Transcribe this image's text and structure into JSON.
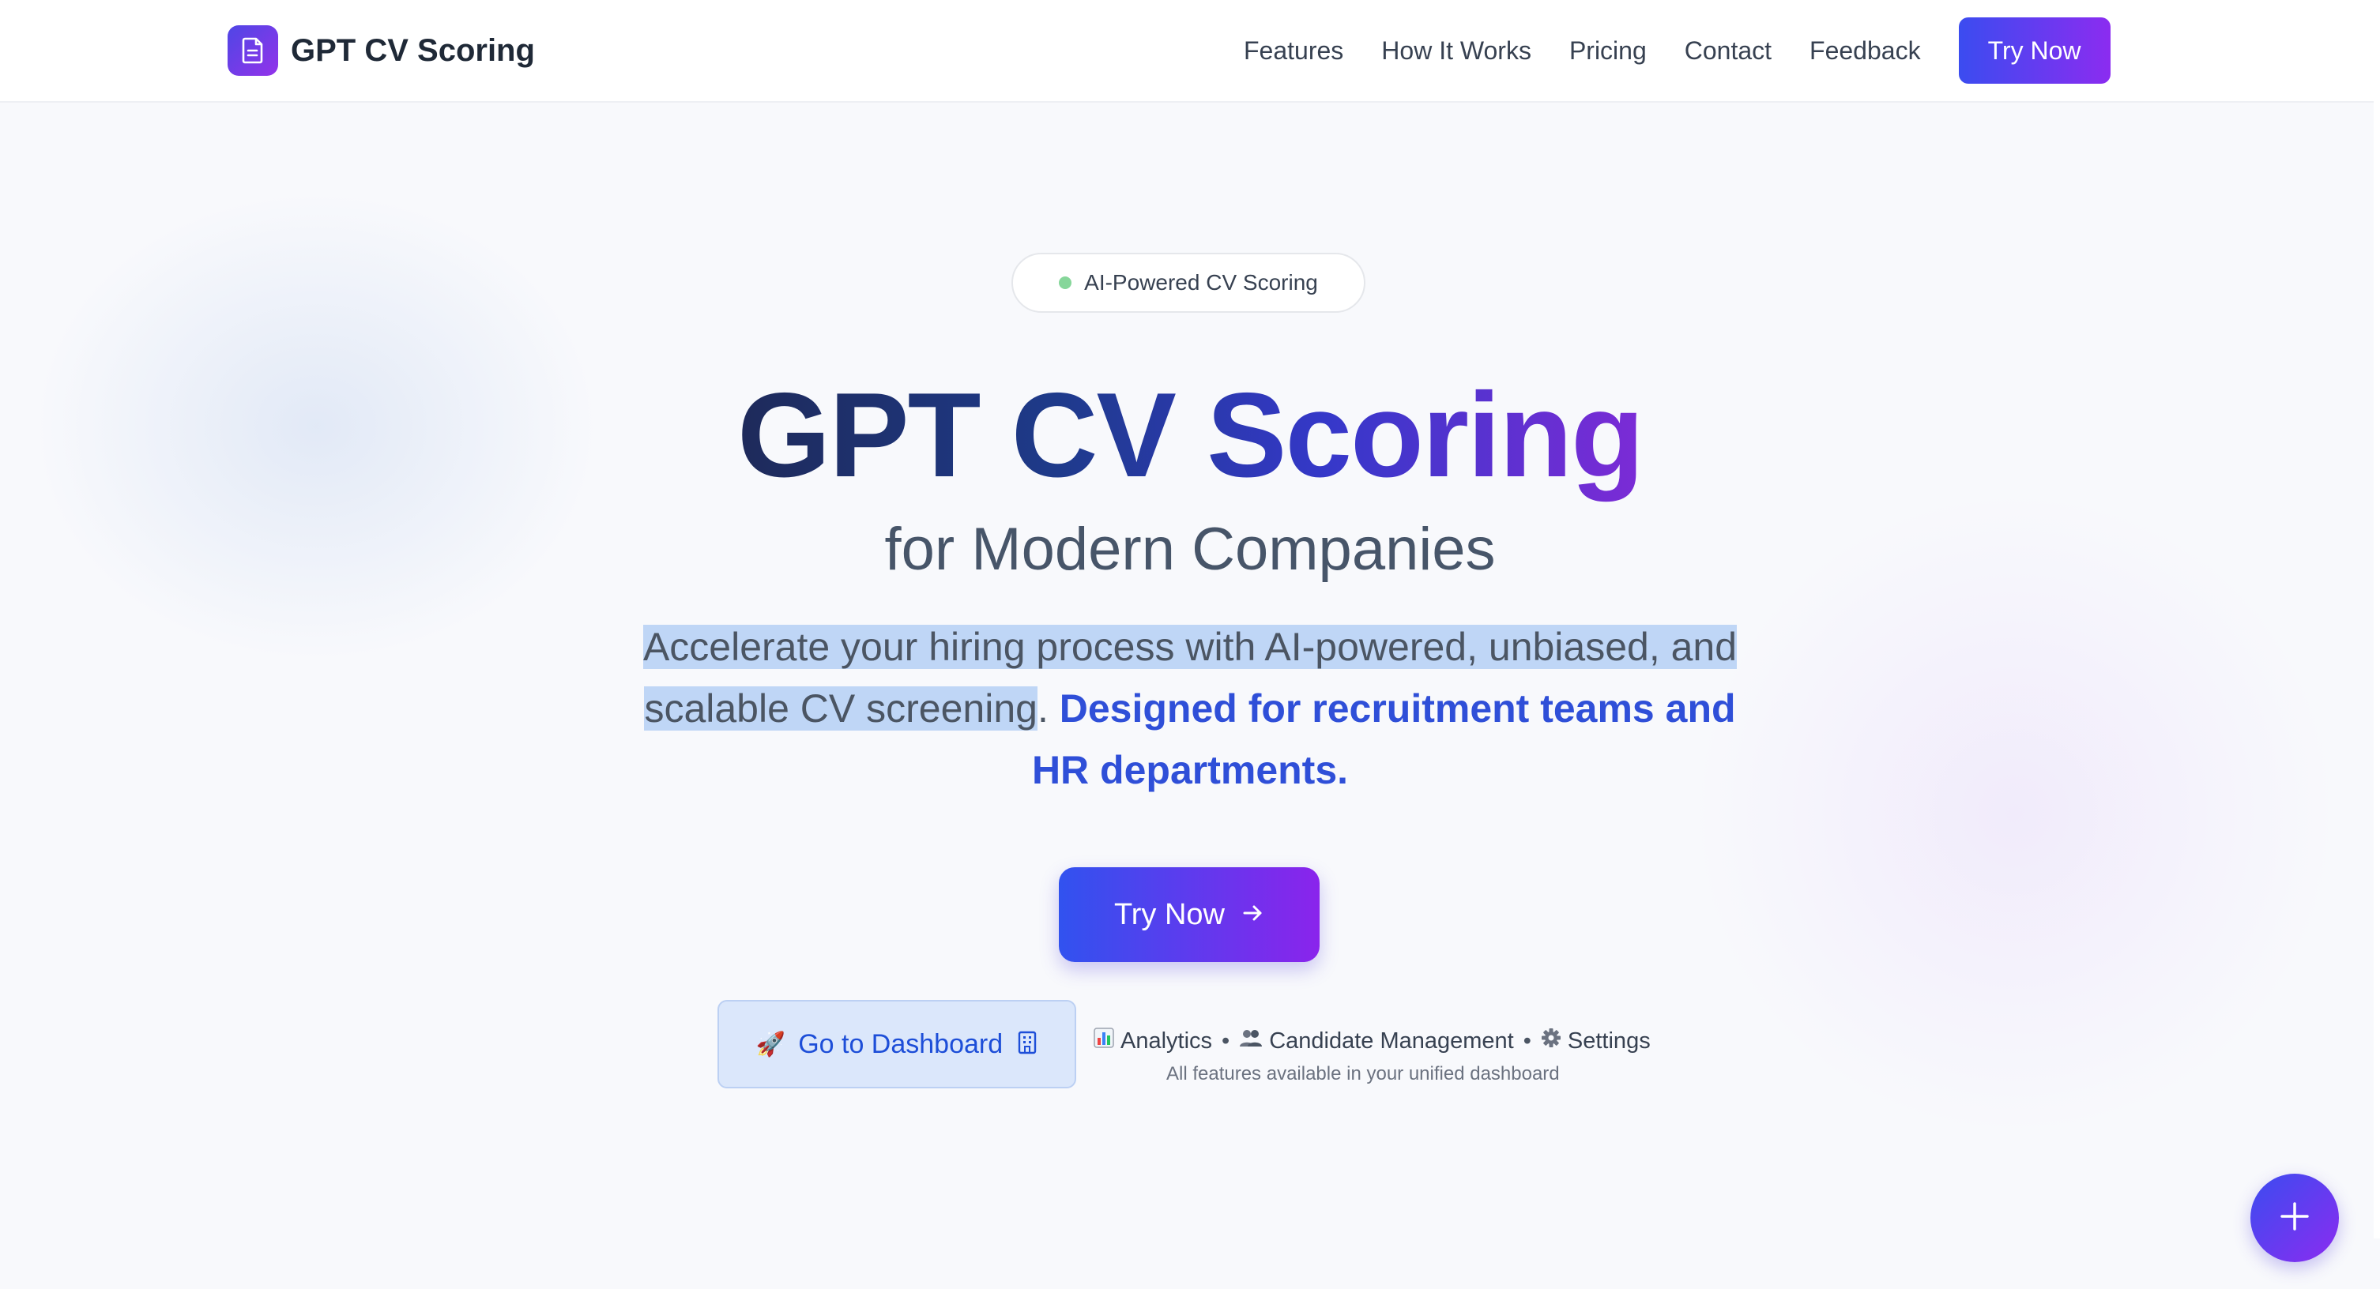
{
  "header": {
    "brand": "GPT CV Scoring",
    "brand_icon": "document-icon",
    "nav": [
      "Features",
      "How It Works",
      "Pricing",
      "Contact",
      "Feedback"
    ],
    "cta": "Try Now"
  },
  "hero": {
    "badge": "AI-Powered CV Scoring",
    "title": "GPT CV Scoring",
    "subtitle": "for Modern Companies",
    "description_highlighted": "Accelerate your hiring process with AI-powered, unbiased, and scalable CV screening",
    "description_period": ".",
    "description_accent": "Designed for recruitment teams and HR departments.",
    "cta": "Try Now",
    "cta_icon": "arrow-right-icon"
  },
  "dashboard": {
    "label": "Go to Dashboard",
    "emoji": "🚀",
    "icon": "building-icon"
  },
  "features": {
    "items": [
      {
        "icon": "bar-chart-icon",
        "label": "Analytics"
      },
      {
        "icon": "users-icon",
        "label": "Candidate Management"
      },
      {
        "icon": "gear-icon",
        "label": "Settings"
      }
    ],
    "separator": "•",
    "note": "All features available in your unified dashboard"
  },
  "fab": {
    "icon": "plus-icon"
  },
  "colors": {
    "accent_start": "#3b4cf0",
    "accent_end": "#8b2cf0",
    "accent_text": "#2f4fd8",
    "highlight": "#bfd6f6",
    "badge_dot": "#86d69a"
  }
}
